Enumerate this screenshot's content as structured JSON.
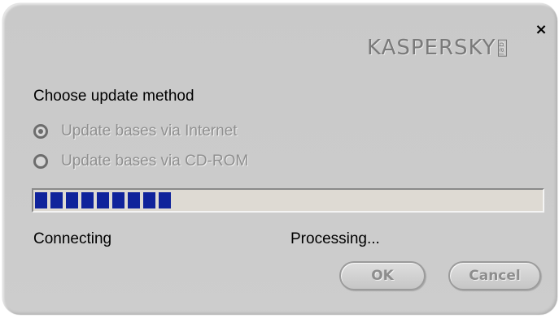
{
  "window": {
    "close_glyph": "×",
    "logo_text": "KASPERSKY",
    "logo_suffix": "lab"
  },
  "update_method": {
    "heading": "Choose update method",
    "options": [
      {
        "label": "Update bases via Internet",
        "selected": true,
        "enabled": false
      },
      {
        "label": "Update bases via CD-ROM",
        "selected": false,
        "enabled": false
      }
    ]
  },
  "progress": {
    "percent": 29,
    "fill_color": "#10239b"
  },
  "status": {
    "left": "Connecting",
    "right": "Processing..."
  },
  "buttons": {
    "ok_label": "OK",
    "cancel_label": "Cancel"
  }
}
